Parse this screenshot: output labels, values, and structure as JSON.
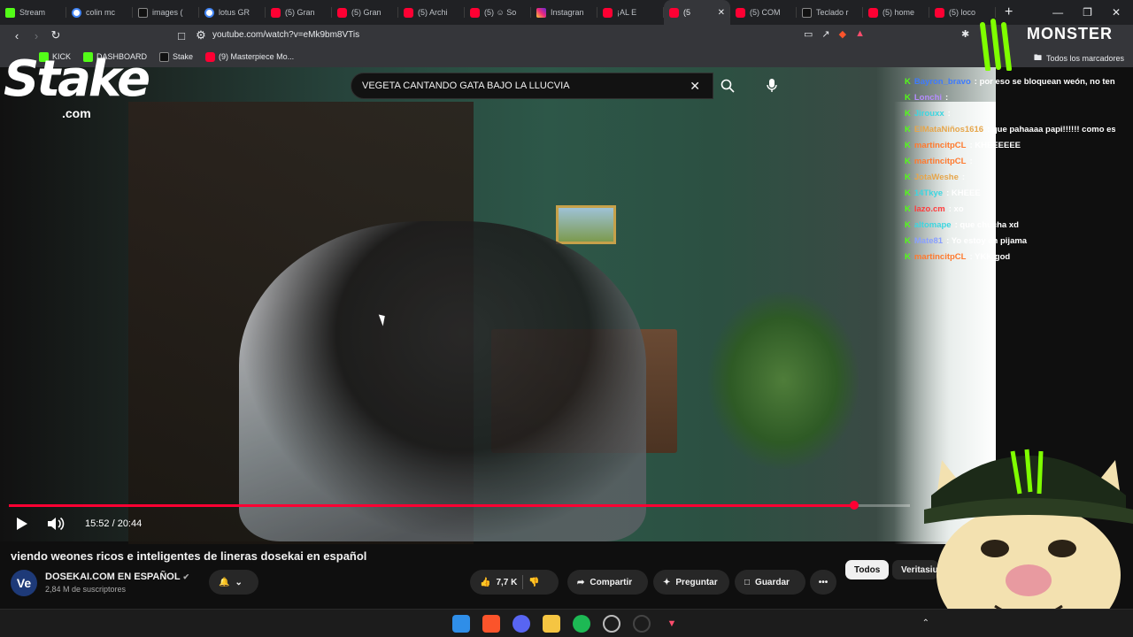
{
  "browser": {
    "tabs": [
      {
        "label": "Stream",
        "icon": "kick-icon",
        "active": false
      },
      {
        "label": "colin mc",
        "icon": "google-icon",
        "active": false
      },
      {
        "label": "images (",
        "icon": "cube-icon",
        "active": false
      },
      {
        "label": "lotus GR",
        "icon": "google-icon",
        "active": false
      },
      {
        "label": "(5) Gran",
        "icon": "youtube-icon",
        "active": false
      },
      {
        "label": "(5) Gran",
        "icon": "youtube-icon",
        "active": false
      },
      {
        "label": "(5) Archi",
        "icon": "youtube-icon",
        "active": false
      },
      {
        "label": "(5) ☺ So",
        "icon": "youtube-icon",
        "active": false
      },
      {
        "label": "Instagran",
        "icon": "instagram-icon",
        "active": false
      },
      {
        "label": "¡AL E",
        "icon": "youtube-icon",
        "active": false
      },
      {
        "label": "(5",
        "icon": "youtube-icon",
        "active": true
      },
      {
        "label": "(5) COM",
        "icon": "youtube-icon",
        "active": false
      },
      {
        "label": "Teclado r",
        "icon": "cube-icon",
        "active": false
      },
      {
        "label": "(5) home",
        "icon": "youtube-icon",
        "active": false
      },
      {
        "label": "(5) loco",
        "icon": "youtube-icon",
        "active": false
      }
    ],
    "new_tab": "+",
    "url": "youtube.com/watch?v=eMk9bm8VTis",
    "bookmarks": [
      {
        "label": "KICK",
        "icon": "kick-icon"
      },
      {
        "label": "DASHBOARD",
        "icon": "kick-icon"
      },
      {
        "label": "Stake",
        "icon": "stake-icon"
      },
      {
        "label": "(9) Masterpiece Mo...",
        "icon": "youtube-icon"
      }
    ],
    "all_bookmarks": "Todos los marcadores"
  },
  "youtube": {
    "search": {
      "query": "VEGETA CANTANDO GATA BAJO LA LLUCVIA"
    },
    "player": {
      "time": "15:52 / 20:44",
      "progress": 0.9381
    },
    "video": {
      "title": "viendo weones ricos e inteligentes de lineras dosekai en español",
      "channel_name": "DOSEKAI.COM  EN ESPAÑOL",
      "channel_avatar": "Ve",
      "subscribers": "2,84 M de suscriptores",
      "likes": "7,7 K",
      "share_label": "Compartir",
      "ask_label": "Preguntar",
      "save_label": "Guardar"
    },
    "chips": {
      "all": "Todos",
      "second": "Veritasiu"
    }
  },
  "overlay": {
    "stake": {
      "logo": "Stake",
      "suffix": ".com"
    },
    "monster": "MONSTER",
    "chat": [
      {
        "user": "Bayron_bravo",
        "text": ": por eso se bloquean weón, no tenía ni idea",
        "color": "#3d7bff"
      },
      {
        "user": "Lonchi",
        "text": ":",
        "color": "#b58cff"
      },
      {
        "user": "Jirouxx",
        "text": ":",
        "color": "#3dd6e0"
      },
      {
        "user": "ElMataNiños1616",
        "text": ": que pahaaaa papi!!!!!! como estas dosekast!?",
        "color": "#e6a64b"
      },
      {
        "user": "martincitpCL",
        "text": ": KHEEEEEE",
        "color": "#ff7a2e"
      },
      {
        "user": "martincitpCL",
        "text": ":",
        "color": "#ff7a2e"
      },
      {
        "user": "JotaWeshe",
        "text": ":",
        "color": "#e6a64b"
      },
      {
        "user": "14Tkye",
        "text": ": KHEEE",
        "color": "#3dd6e0"
      },
      {
        "user": "lazo.cm",
        "text": ": xo",
        "color": "#ff3d3d"
      },
      {
        "user": "altomape",
        "text": ": que chucha xd",
        "color": "#3dd6e0"
      },
      {
        "user": "Mate81",
        "text": ": Yo estoy en pijama",
        "color": "#8aa0ff"
      },
      {
        "user": "martincitpCL",
        "text": ": YKK god",
        "color": "#ff7a2e"
      }
    ]
  },
  "colors": {
    "accent": "#ff0033",
    "kick_green": "#53fc18"
  }
}
